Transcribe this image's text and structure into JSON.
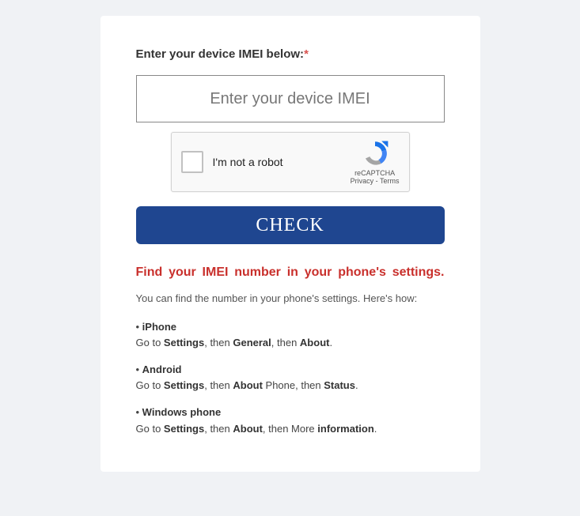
{
  "form": {
    "label": "Enter your device IMEI below:",
    "required_mark": "*",
    "placeholder": "Enter your device IMEI",
    "submit_label": "CHECK"
  },
  "recaptcha": {
    "label": "I'm not a robot",
    "brand": "reCAPTCHA",
    "privacy": "Privacy",
    "sep": " - ",
    "terms": "Terms"
  },
  "instructions": {
    "heading": "Find your IMEI number in your phone's settings.",
    "intro": "You can find the number in your phone's settings. Here's how:",
    "platforms": [
      {
        "name": "iPhone",
        "pre": "Go to ",
        "s1": "Settings",
        "mid1": ", then ",
        "s2": "General",
        "mid2": ", then ",
        "s3": "About",
        "post": "."
      },
      {
        "name": "Android",
        "pre": "Go to ",
        "s1": "Settings",
        "mid1": ", then ",
        "s2": "About",
        "mid2": " Phone, then ",
        "s3": "Status",
        "post": "."
      },
      {
        "name": "Windows phone",
        "pre": "Go to ",
        "s1": "Settings",
        "mid1": ", then ",
        "s2": "About",
        "mid2": ", then More ",
        "s3": "information",
        "post": "."
      }
    ]
  }
}
